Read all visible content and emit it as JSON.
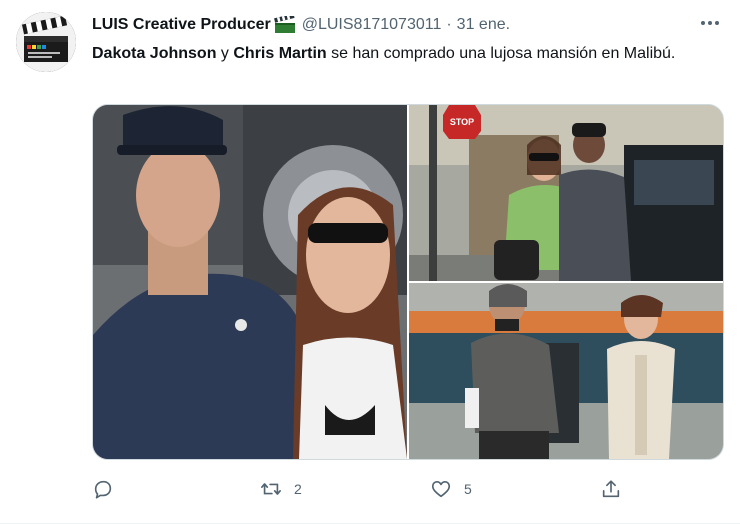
{
  "tweet": {
    "author_name": "LUIS Creative Producer",
    "handle": "@LUIS8171073011",
    "separator": "·",
    "date": "31 ene.",
    "text": {
      "name1": "Dakota Johnson",
      "conj": " y ",
      "name2": "Chris Martin",
      "rest": " se han comprado una lujosa mansión en Malibú."
    },
    "images": [
      {
        "name": "photo-couple-closeup",
        "stop_sign": ""
      },
      {
        "name": "photo-couple-street",
        "stop_sign": "STOP"
      },
      {
        "name": "photo-couple-walking",
        "stop_sign": ""
      }
    ]
  },
  "actions": {
    "reply_count": "",
    "retweet_count": "2",
    "like_count": "5",
    "share_count": ""
  },
  "icons": {
    "more": "more-horizontal-icon",
    "reply": "reply-icon",
    "retweet": "retweet-icon",
    "like": "heart-icon",
    "share": "share-icon",
    "clapper": "clapperboard-emoji"
  },
  "colors": {
    "text": "#0f1419",
    "muted": "#536471",
    "border": "#cfd9de"
  }
}
